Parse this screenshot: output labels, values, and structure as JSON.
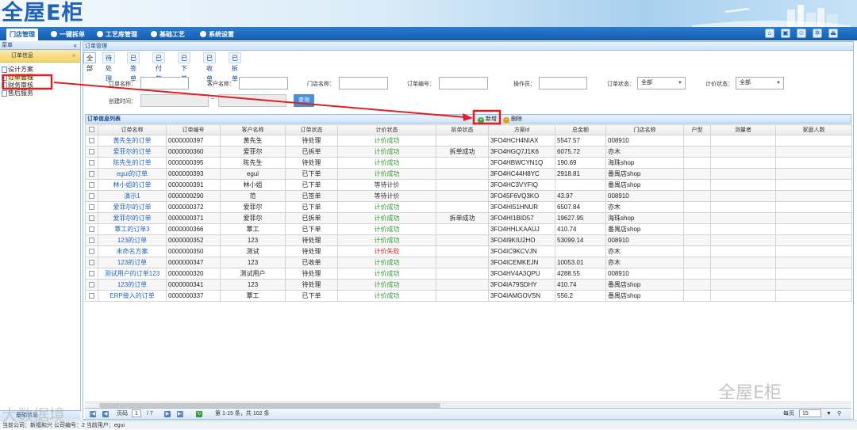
{
  "app": {
    "logo": "全屋E柜"
  },
  "nav": {
    "items": [
      {
        "label": "门店管理",
        "active": true
      },
      {
        "label": "一键拆单"
      },
      {
        "label": "工艺库管理"
      },
      {
        "label": "基础工艺"
      },
      {
        "label": "系统设置"
      }
    ],
    "icons": [
      "home-icon",
      "bag-icon",
      "user-icon",
      "gear-icon",
      "exit-icon"
    ]
  },
  "sidebar": {
    "header": "菜单",
    "section": "订单信息",
    "items": [
      "设计方案",
      "订单管理",
      "财务审核",
      "售后服务"
    ],
    "footer": "基础信息"
  },
  "main": {
    "header": "订单管理",
    "tabs": [
      "全部",
      "待处理",
      "已签单",
      "已付款",
      "已下单",
      "已收单",
      "已拆单"
    ],
    "filters": {
      "order_name": "订单名称：",
      "customer_name": "客户名称：",
      "store_name": "门店名称：",
      "order_no": "订单编号：",
      "operator": "操作员：",
      "order_status": "订单状态：",
      "order_status_value": "全部",
      "price_status": "计价状态：",
      "price_status_value": "全部",
      "created_time": "创建时间：",
      "range_sep": "~",
      "query": "查询"
    },
    "list_title": "订单信息列表",
    "add": "新增",
    "delete": "删除"
  },
  "grid": {
    "columns": [
      "订单名称",
      "订单编号",
      "客户名称",
      "订单状态",
      "计价状态",
      "拆单状态",
      "方案id",
      "总金额",
      "门店名称",
      "户型",
      "测量者",
      "家庭人数"
    ],
    "rows": [
      [
        "黄先生的订单",
        "0000000397",
        "黄先生",
        "待处理",
        "计价成功",
        "",
        "3FO4HCH4NIAX",
        "5547.57",
        "008910",
        "",
        "",
        ""
      ],
      [
        "爱菲尔的订单",
        "0000000360",
        "爱菲尔",
        "已拆单",
        "计价成功",
        "拆单成功",
        "3FO4HGQ7J1K6",
        "6075.72",
        "亦木",
        "",
        "",
        ""
      ],
      [
        "陈先生的订单",
        "0000000395",
        "陈先生",
        "待处理",
        "计价成功",
        "",
        "3FO4HBWCYN1Q",
        "190.69",
        "海珠shop",
        "",
        "",
        ""
      ],
      [
        "egui的订单",
        "0000000393",
        "egui",
        "已下单",
        "计价成功",
        "",
        "3FO4HC44H8YC",
        "2918.81",
        "番禺店shop",
        "",
        "",
        ""
      ],
      [
        "林小姐的订单",
        "0000000391",
        "林小姐",
        "已下单",
        "等待计价",
        "",
        "3FO4HC3VYFIQ",
        "",
        "番禺店shop",
        "",
        "",
        ""
      ],
      [
        "演示1",
        "0000000290",
        "范",
        "已签单",
        "等待计价",
        "",
        "3FO45F6VQ3KO",
        "43.97",
        "008910",
        "",
        "",
        ""
      ],
      [
        "爱菲尔的订单",
        "0000000372",
        "爱菲尔",
        "已下单",
        "计价成功",
        "",
        "3FO4HI51HNUR",
        "6507.84",
        "亦木",
        "",
        "",
        ""
      ],
      [
        "爱菲尔的订单",
        "0000000371",
        "爱菲尔",
        "已拆单",
        "计价成功",
        "拆单成功",
        "3FO4HI1BID57",
        "19627.95",
        "海珠shop",
        "",
        "",
        ""
      ],
      [
        "覃工的订单3",
        "0000000366",
        "覃工",
        "已下单",
        "计价成功",
        "",
        "3FO4HHLKAAUJ",
        "410.74",
        "番禺店shop",
        "",
        "",
        ""
      ],
      [
        "123的订单",
        "0000000352",
        "123",
        "待处理",
        "计价成功",
        "",
        "3FO4I9KIU2HO",
        "53099.14",
        "008910",
        "",
        "",
        ""
      ],
      [
        "未命名方案",
        "0000000350",
        "测试",
        "待处理",
        "计价失败",
        "",
        "3FO4IC9KCVJN",
        "",
        "亦木",
        "",
        "",
        ""
      ],
      [
        "123的订单",
        "0000000347",
        "123",
        "已收单",
        "计价成功",
        "",
        "3FO4ICEMKEJN",
        "10053.01",
        "亦木",
        "",
        "",
        ""
      ],
      [
        "测试用户的订单123",
        "0000000320",
        "测试用户",
        "待处理",
        "计价成功",
        "",
        "3FO4HV4A3QPU",
        "4288.55",
        "008910",
        "",
        "",
        ""
      ],
      [
        "123的订单",
        "0000000341",
        "123",
        "待处理",
        "计价成功",
        "",
        "3FO4IA79SDHY",
        "410.74",
        "番禺店shop",
        "",
        "",
        ""
      ],
      [
        "ERP接入的订单",
        "0000000337",
        "覃工",
        "已下单",
        "计价成功",
        "",
        "3FO4IAMGOVSN",
        "556.2",
        "番禺店shop",
        "",
        "",
        ""
      ]
    ]
  },
  "pager": {
    "page_label": "页码",
    "page": "1",
    "total_pages": "/ 7",
    "summary": "第 1-15 条，共 102 条",
    "per_page_label": "每页",
    "per_page": "15"
  },
  "status": "当前公司：新福和兴   公司编号：2   当前用户：egui",
  "watermark": "全屋E柜",
  "watermark2": "大数据境"
}
